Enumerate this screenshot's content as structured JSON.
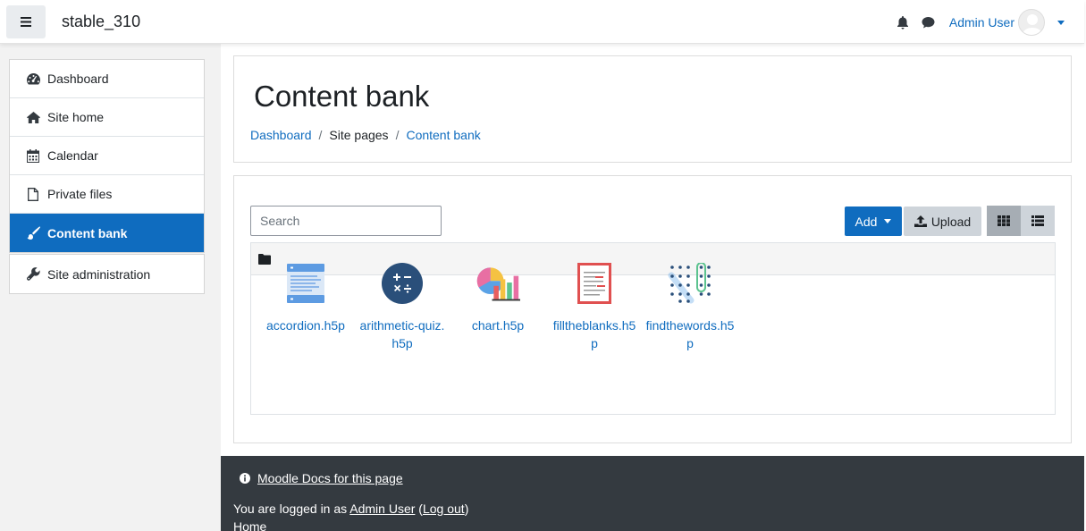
{
  "navbar": {
    "site_name": "stable_310",
    "user_name": "Admin User",
    "menu_icon": "hamburger-icon",
    "notification_icon": "bell-icon",
    "messages_icon": "comment-icon"
  },
  "drawer": {
    "primary": [
      {
        "label": "Dashboard",
        "icon": "dashboard-icon"
      },
      {
        "label": "Site home",
        "icon": "home-icon"
      },
      {
        "label": "Calendar",
        "icon": "calendar-icon"
      },
      {
        "label": "Private files",
        "icon": "file-icon"
      },
      {
        "label": "Content bank",
        "icon": "brush-icon",
        "active": true
      }
    ],
    "secondary": [
      {
        "label": "Site administration",
        "icon": "wrench-icon"
      }
    ]
  },
  "header": {
    "title": "Content bank",
    "breadcrumb": [
      {
        "label": "Dashboard",
        "link": true
      },
      {
        "label": "Site pages",
        "link": false
      },
      {
        "label": "Content bank",
        "link": true
      }
    ],
    "separator": "/"
  },
  "content": {
    "search_placeholder": "Search",
    "add_label": "Add",
    "upload_label": "Upload",
    "files": [
      {
        "name": "accordion.h5p",
        "icon": "accordion-icon"
      },
      {
        "name": "arithmetic-quiz.h5p",
        "icon": "arithmetic-icon"
      },
      {
        "name": "chart.h5p",
        "icon": "chart-icon"
      },
      {
        "name": "filltheblanks.h5p",
        "icon": "fill-blanks-icon"
      },
      {
        "name": "findthewords.h5p",
        "icon": "find-words-icon"
      }
    ]
  },
  "footer": {
    "docs_link": "Moodle Docs for this page",
    "logged_in_prefix": "You are logged in as ",
    "logged_in_user": "Admin User",
    "logout_open": " (",
    "logout_label": "Log out",
    "logout_close": ")",
    "home_label": "Home"
  },
  "colors": {
    "primary": "#0f6cbf",
    "footer_bg": "#343a40",
    "drawer_bg": "#f2f2f2"
  }
}
